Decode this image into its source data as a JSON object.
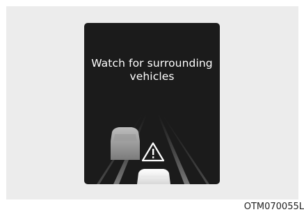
{
  "display": {
    "message_line1": "Watch for surrounding",
    "message_line2": "vehicles"
  },
  "icons": {
    "warning": "warning-triangle-icon",
    "own_vehicle": "own-car-icon",
    "surrounding_vehicle": "surrounding-car-icon"
  },
  "figure": {
    "code": "OTM070055L"
  },
  "colors": {
    "panel_background": "#ececec",
    "display_background": "#1b1b1b",
    "text": "#ffffff"
  }
}
